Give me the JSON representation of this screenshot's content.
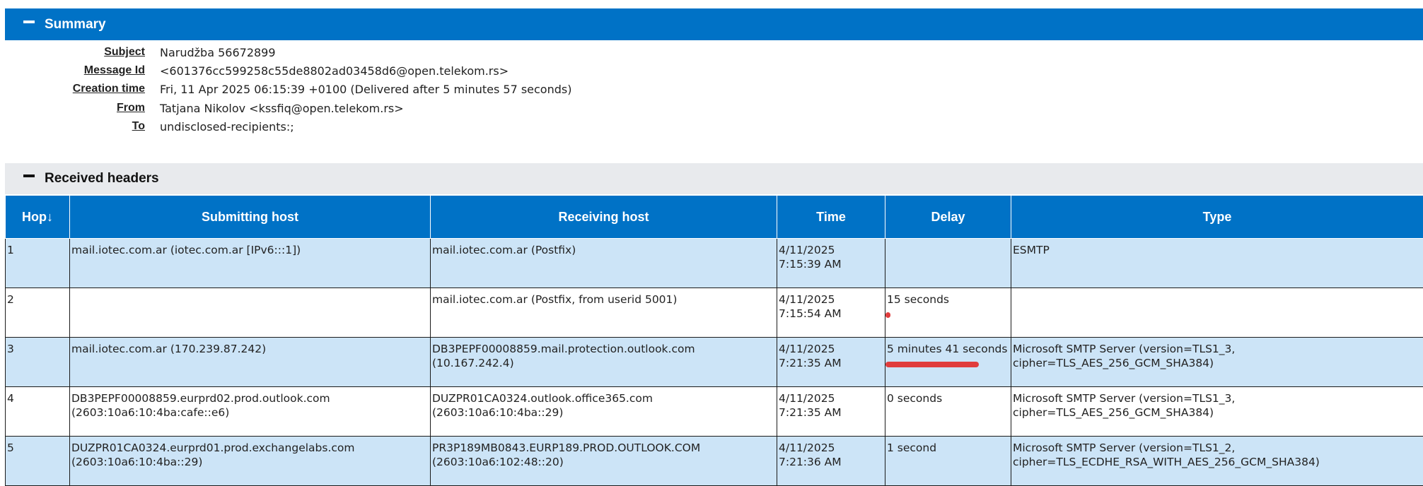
{
  "summary": {
    "header": "Summary",
    "rows": [
      {
        "label": "Subject",
        "value": "Narudžba 56672899"
      },
      {
        "label": "Message Id",
        "value": "<601376cc599258c55de8802ad03458d6@open.telekom.rs>"
      },
      {
        "label": "Creation time",
        "value": "Fri, 11 Apr 2025 06:15:39 +0100 (Delivered after 5 minutes 57 seconds)"
      },
      {
        "label": "From",
        "value": "Tatjana Nikolov <kssfiq@open.telekom.rs>"
      },
      {
        "label": "To",
        "value": "undisclosed-recipients:;"
      }
    ]
  },
  "received": {
    "header": "Received headers",
    "columns": [
      "Hop↓",
      "Submitting host",
      "Receiving host",
      "Time",
      "Delay",
      "Type"
    ],
    "delay_bar_color": "#e03c3c",
    "rows": [
      {
        "hop": "1",
        "submitting": [
          "mail.iotec.com.ar (iotec.com.ar [IPv6:::1])"
        ],
        "receiving": [
          "mail.iotec.com.ar (Postfix)"
        ],
        "time": [
          "4/11/2025",
          "7:15:39 AM"
        ],
        "delay": "",
        "delay_fraction": 0,
        "type": [
          "ESMTP"
        ]
      },
      {
        "hop": "2",
        "submitting": [],
        "receiving": [
          "mail.iotec.com.ar (Postfix, from userid 5001)"
        ],
        "time": [
          "4/11/2025",
          "7:15:54 AM"
        ],
        "delay": "15 seconds",
        "delay_fraction": 0.044,
        "type": []
      },
      {
        "hop": "3",
        "submitting": [
          "mail.iotec.com.ar (170.239.87.242)"
        ],
        "receiving": [
          "DB3PEPF00008859.mail.protection.outlook.com (10.167.242.4)"
        ],
        "time": [
          "4/11/2025",
          "7:21:35 AM"
        ],
        "delay": "5 minutes 41 seconds",
        "delay_fraction": 1,
        "type": [
          "Microsoft SMTP Server (version=TLS1_3, cipher=TLS_AES_256_GCM_SHA384)"
        ]
      },
      {
        "hop": "4",
        "submitting": [
          "DB3PEPF00008859.eurprd02.prod.outlook.com",
          "(2603:10a6:10:4ba:cafe::e6)"
        ],
        "receiving": [
          "DUZPR01CA0324.outlook.office365.com (2603:10a6:10:4ba::29)"
        ],
        "time": [
          "4/11/2025",
          "7:21:35 AM"
        ],
        "delay": "0 seconds",
        "delay_fraction": 0,
        "type": [
          "Microsoft SMTP Server (version=TLS1_3, cipher=TLS_AES_256_GCM_SHA384)"
        ]
      },
      {
        "hop": "5",
        "submitting": [
          "DUZPR01CA0324.eurprd01.prod.exchangelabs.com",
          "(2603:10a6:10:4ba::29)"
        ],
        "receiving": [
          "PR3P189MB0843.EURP189.PROD.OUTLOOK.COM",
          "(2603:10a6:102:48::20)"
        ],
        "time": [
          "4/11/2025",
          "7:21:36 AM"
        ],
        "delay": "1 second",
        "delay_fraction": 0,
        "type": [
          "Microsoft SMTP Server (version=TLS1_2,",
          "cipher=TLS_ECDHE_RSA_WITH_AES_256_GCM_SHA384)"
        ]
      }
    ]
  }
}
